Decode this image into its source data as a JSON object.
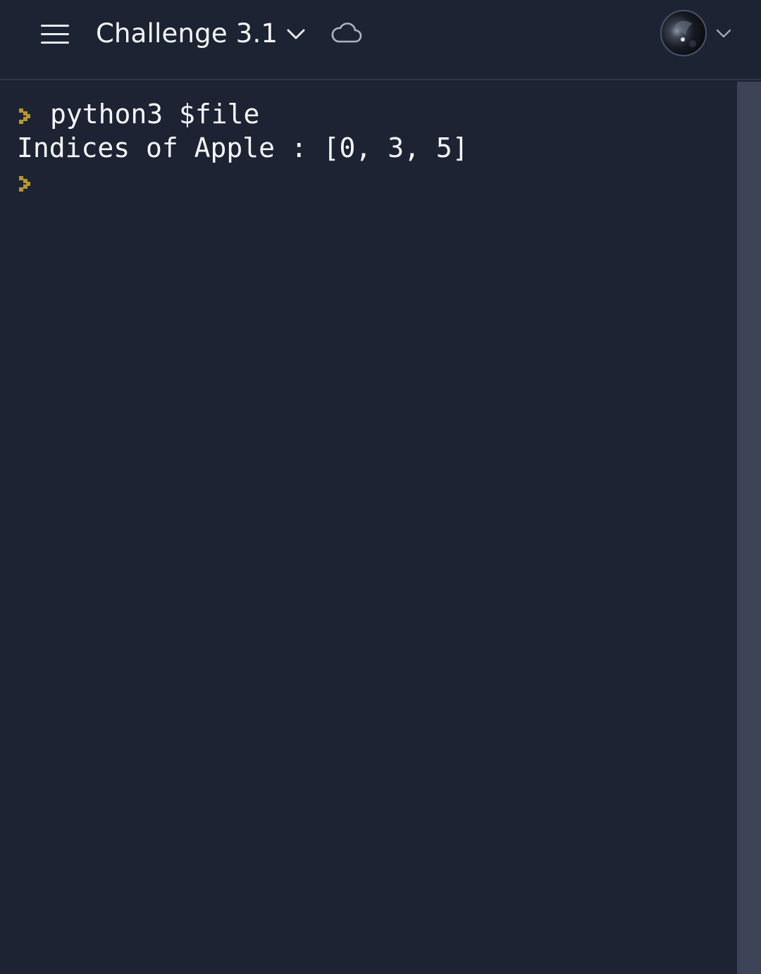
{
  "header": {
    "title": "Challenge 3.1",
    "menu_icon": "hamburger-menu-icon",
    "title_dropdown_icon": "chevron-down-icon",
    "cloud_icon": "cloud-icon",
    "avatar_icon": "user-avatar",
    "avatar_dropdown_icon": "chevron-down-icon"
  },
  "terminal": {
    "prompt_icon": "prompt-chevron-icon",
    "prompt_color": "#b9972c",
    "lines": [
      {
        "prompt": true,
        "text": "python3 $file"
      },
      {
        "prompt": false,
        "text": "Indices of Apple : [0, 3, 5]"
      },
      {
        "prompt": true,
        "text": ""
      }
    ]
  },
  "colors": {
    "background": "#1d2333",
    "text": "#f5f6f8",
    "scrollbar": "#3d4457"
  }
}
